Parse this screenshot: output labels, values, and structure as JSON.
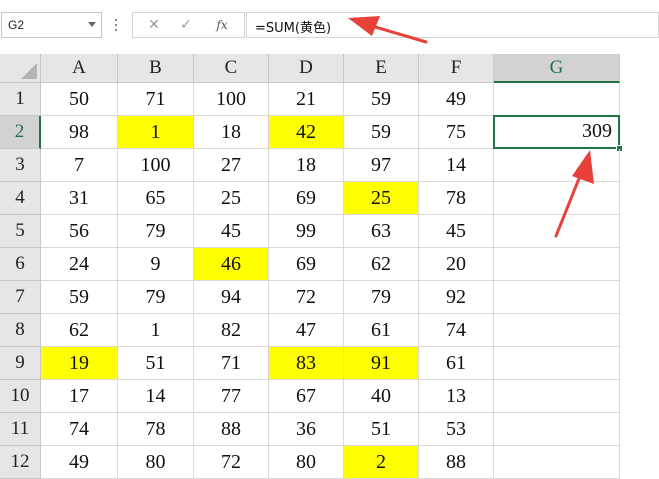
{
  "formula_bar": {
    "name_box": "G2",
    "cancel_glyph": "✕",
    "enter_glyph": "✓",
    "fx_label": "fx",
    "formula": "=SUM(黄色)"
  },
  "columns": [
    "A",
    "B",
    "C",
    "D",
    "E",
    "F",
    "G"
  ],
  "rows": [
    {
      "num": "1",
      "cells": [
        "50",
        "71",
        "100",
        "21",
        "59",
        "49",
        ""
      ],
      "yellow": []
    },
    {
      "num": "2",
      "cells": [
        "98",
        "1",
        "18",
        "42",
        "59",
        "75",
        "309"
      ],
      "yellow": [
        1,
        3
      ]
    },
    {
      "num": "3",
      "cells": [
        "7",
        "100",
        "27",
        "18",
        "97",
        "14",
        ""
      ],
      "yellow": []
    },
    {
      "num": "4",
      "cells": [
        "31",
        "65",
        "25",
        "69",
        "25",
        "78",
        ""
      ],
      "yellow": [
        4
      ]
    },
    {
      "num": "5",
      "cells": [
        "56",
        "79",
        "45",
        "99",
        "63",
        "45",
        ""
      ],
      "yellow": []
    },
    {
      "num": "6",
      "cells": [
        "24",
        "9",
        "46",
        "69",
        "62",
        "20",
        ""
      ],
      "yellow": [
        2
      ]
    },
    {
      "num": "7",
      "cells": [
        "59",
        "79",
        "94",
        "72",
        "79",
        "92",
        ""
      ],
      "yellow": []
    },
    {
      "num": "8",
      "cells": [
        "62",
        "1",
        "82",
        "47",
        "61",
        "74",
        ""
      ],
      "yellow": []
    },
    {
      "num": "9",
      "cells": [
        "19",
        "51",
        "71",
        "83",
        "91",
        "61",
        ""
      ],
      "yellow": [
        0,
        3,
        4
      ]
    },
    {
      "num": "10",
      "cells": [
        "17",
        "14",
        "77",
        "67",
        "40",
        "13",
        ""
      ],
      "yellow": []
    },
    {
      "num": "11",
      "cells": [
        "74",
        "78",
        "88",
        "36",
        "51",
        "53",
        ""
      ],
      "yellow": []
    },
    {
      "num": "12",
      "cells": [
        "49",
        "80",
        "72",
        "80",
        "2",
        "88",
        ""
      ],
      "yellow": [
        4
      ]
    }
  ],
  "selection": {
    "column": "G",
    "row": "2"
  },
  "colors": {
    "highlight": "#ffff00",
    "selection": "#217346",
    "annotation_arrow": "#e8413a"
  }
}
